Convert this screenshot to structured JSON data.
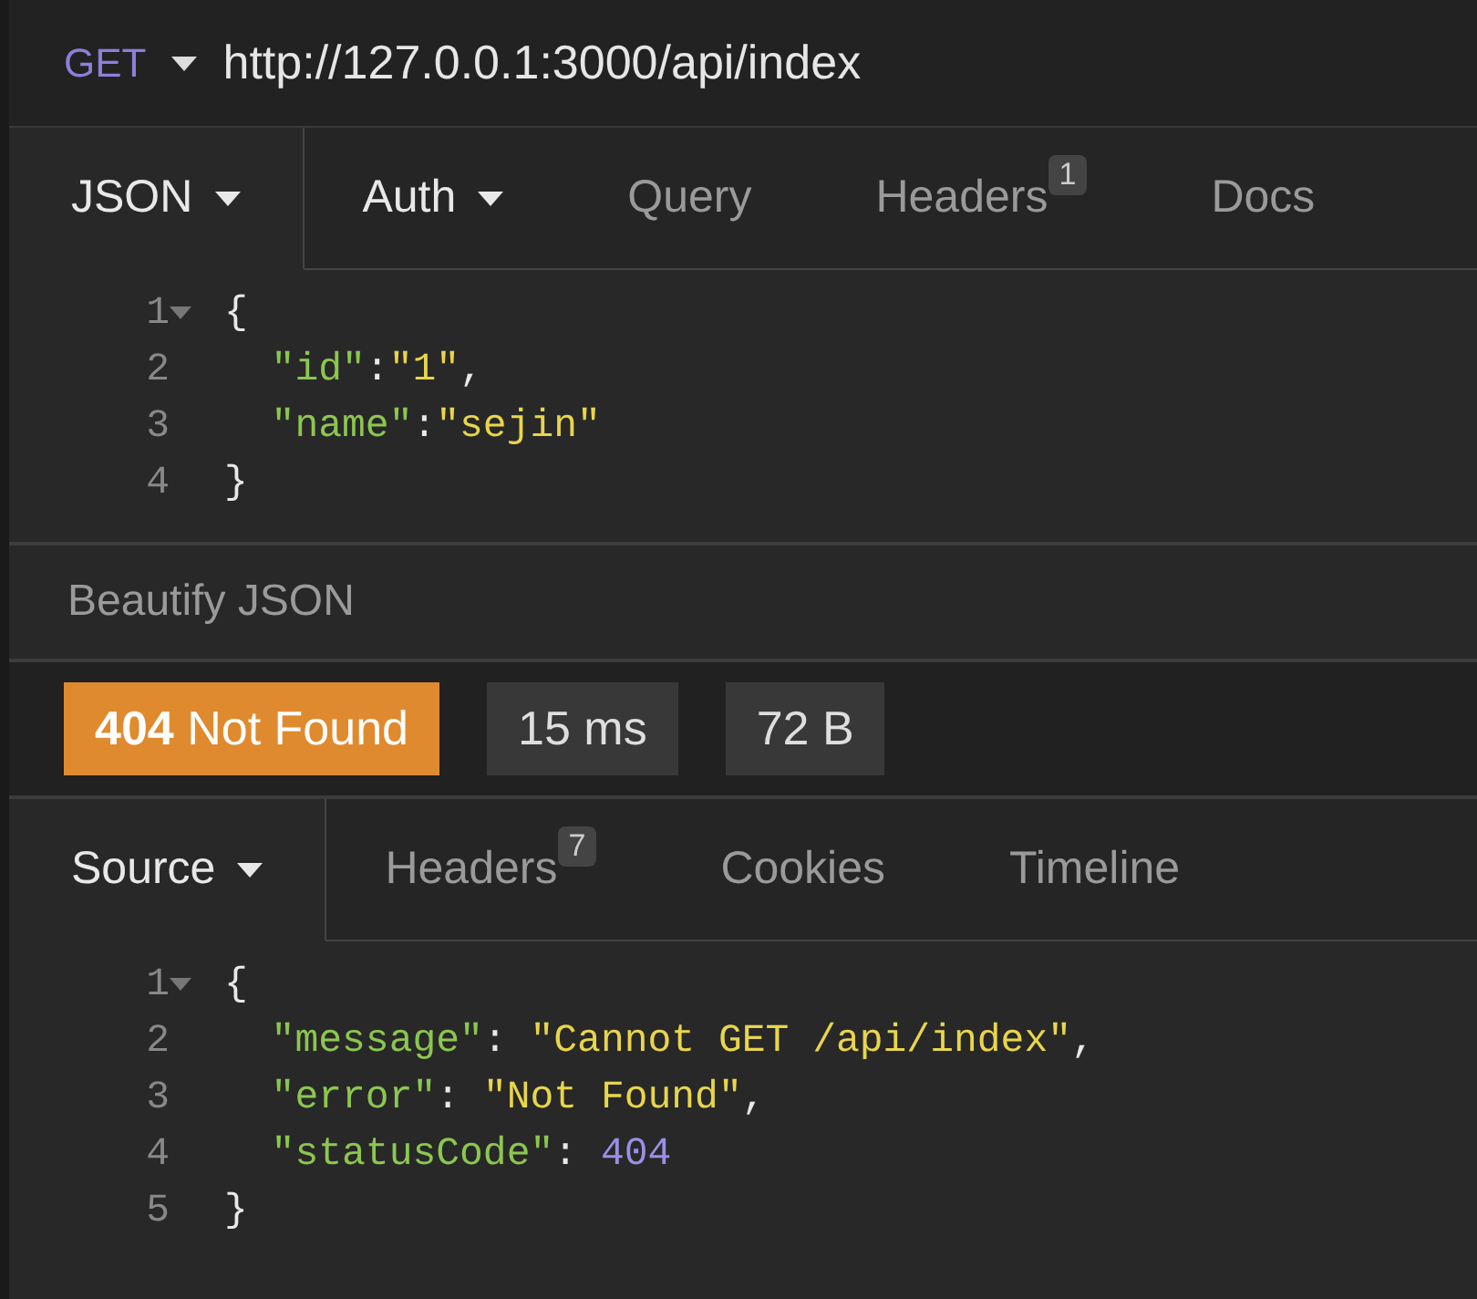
{
  "request": {
    "method": "GET",
    "url": "http://127.0.0.1:3000/api/index"
  },
  "request_tabs": [
    {
      "label": "JSON",
      "selected": true,
      "dropdown": true
    },
    {
      "label": "Auth",
      "selected": false,
      "dropdown": true
    },
    {
      "label": "Query",
      "selected": false,
      "dropdown": false
    },
    {
      "label": "Headers",
      "selected": false,
      "dropdown": false,
      "badge": "1"
    },
    {
      "label": "Docs",
      "selected": false,
      "dropdown": false
    }
  ],
  "request_body": {
    "lines": [
      {
        "number": "1",
        "foldable": true,
        "tokens": [
          {
            "kind": "punct",
            "text": "{"
          }
        ]
      },
      {
        "number": "2",
        "foldable": false,
        "tokens": [
          {
            "kind": "key",
            "text": "  \"id\""
          },
          {
            "kind": "punct",
            "text": ":"
          },
          {
            "kind": "string",
            "text": "\"1\""
          },
          {
            "kind": "punct",
            "text": ","
          }
        ]
      },
      {
        "number": "3",
        "foldable": false,
        "tokens": [
          {
            "kind": "key",
            "text": "  \"name\""
          },
          {
            "kind": "punct",
            "text": ":"
          },
          {
            "kind": "string",
            "text": "\"sejin\""
          }
        ]
      },
      {
        "number": "4",
        "foldable": false,
        "tokens": [
          {
            "kind": "punct",
            "text": "}"
          }
        ]
      }
    ]
  },
  "beautify_button": "Beautify JSON",
  "response_stats": [
    {
      "kind": "status",
      "text": "**404** Not Found"
    },
    {
      "kind": "plain",
      "text": "15 ms"
    },
    {
      "kind": "plain",
      "text": "72 B"
    }
  ],
  "response_tabs": [
    {
      "label": "Source",
      "selected": true,
      "dropdown": true
    },
    {
      "label": "Headers",
      "selected": false,
      "dropdown": false,
      "badge": "7"
    },
    {
      "label": "Cookies",
      "selected": false,
      "dropdown": false
    },
    {
      "label": "Timeline",
      "selected": false,
      "dropdown": false
    }
  ],
  "response_body": {
    "lines": [
      {
        "number": "1",
        "foldable": true,
        "tokens": [
          {
            "kind": "punct",
            "text": "{"
          }
        ]
      },
      {
        "number": "2",
        "foldable": false,
        "tokens": [
          {
            "kind": "key",
            "text": "  \"message\""
          },
          {
            "kind": "punct",
            "text": ": "
          },
          {
            "kind": "string",
            "text": "\"Cannot GET /api/index\""
          },
          {
            "kind": "punct",
            "text": ","
          }
        ]
      },
      {
        "number": "3",
        "foldable": false,
        "tokens": [
          {
            "kind": "key",
            "text": "  \"error\""
          },
          {
            "kind": "punct",
            "text": ": "
          },
          {
            "kind": "string",
            "text": "\"Not Found\""
          },
          {
            "kind": "punct",
            "text": ","
          }
        ]
      },
      {
        "number": "4",
        "foldable": false,
        "tokens": [
          {
            "kind": "key",
            "text": "  \"statusCode\""
          },
          {
            "kind": "punct",
            "text": ": "
          },
          {
            "kind": "number",
            "text": "404"
          }
        ]
      },
      {
        "number": "5",
        "foldable": false,
        "tokens": [
          {
            "kind": "punct",
            "text": "}"
          }
        ]
      }
    ]
  }
}
